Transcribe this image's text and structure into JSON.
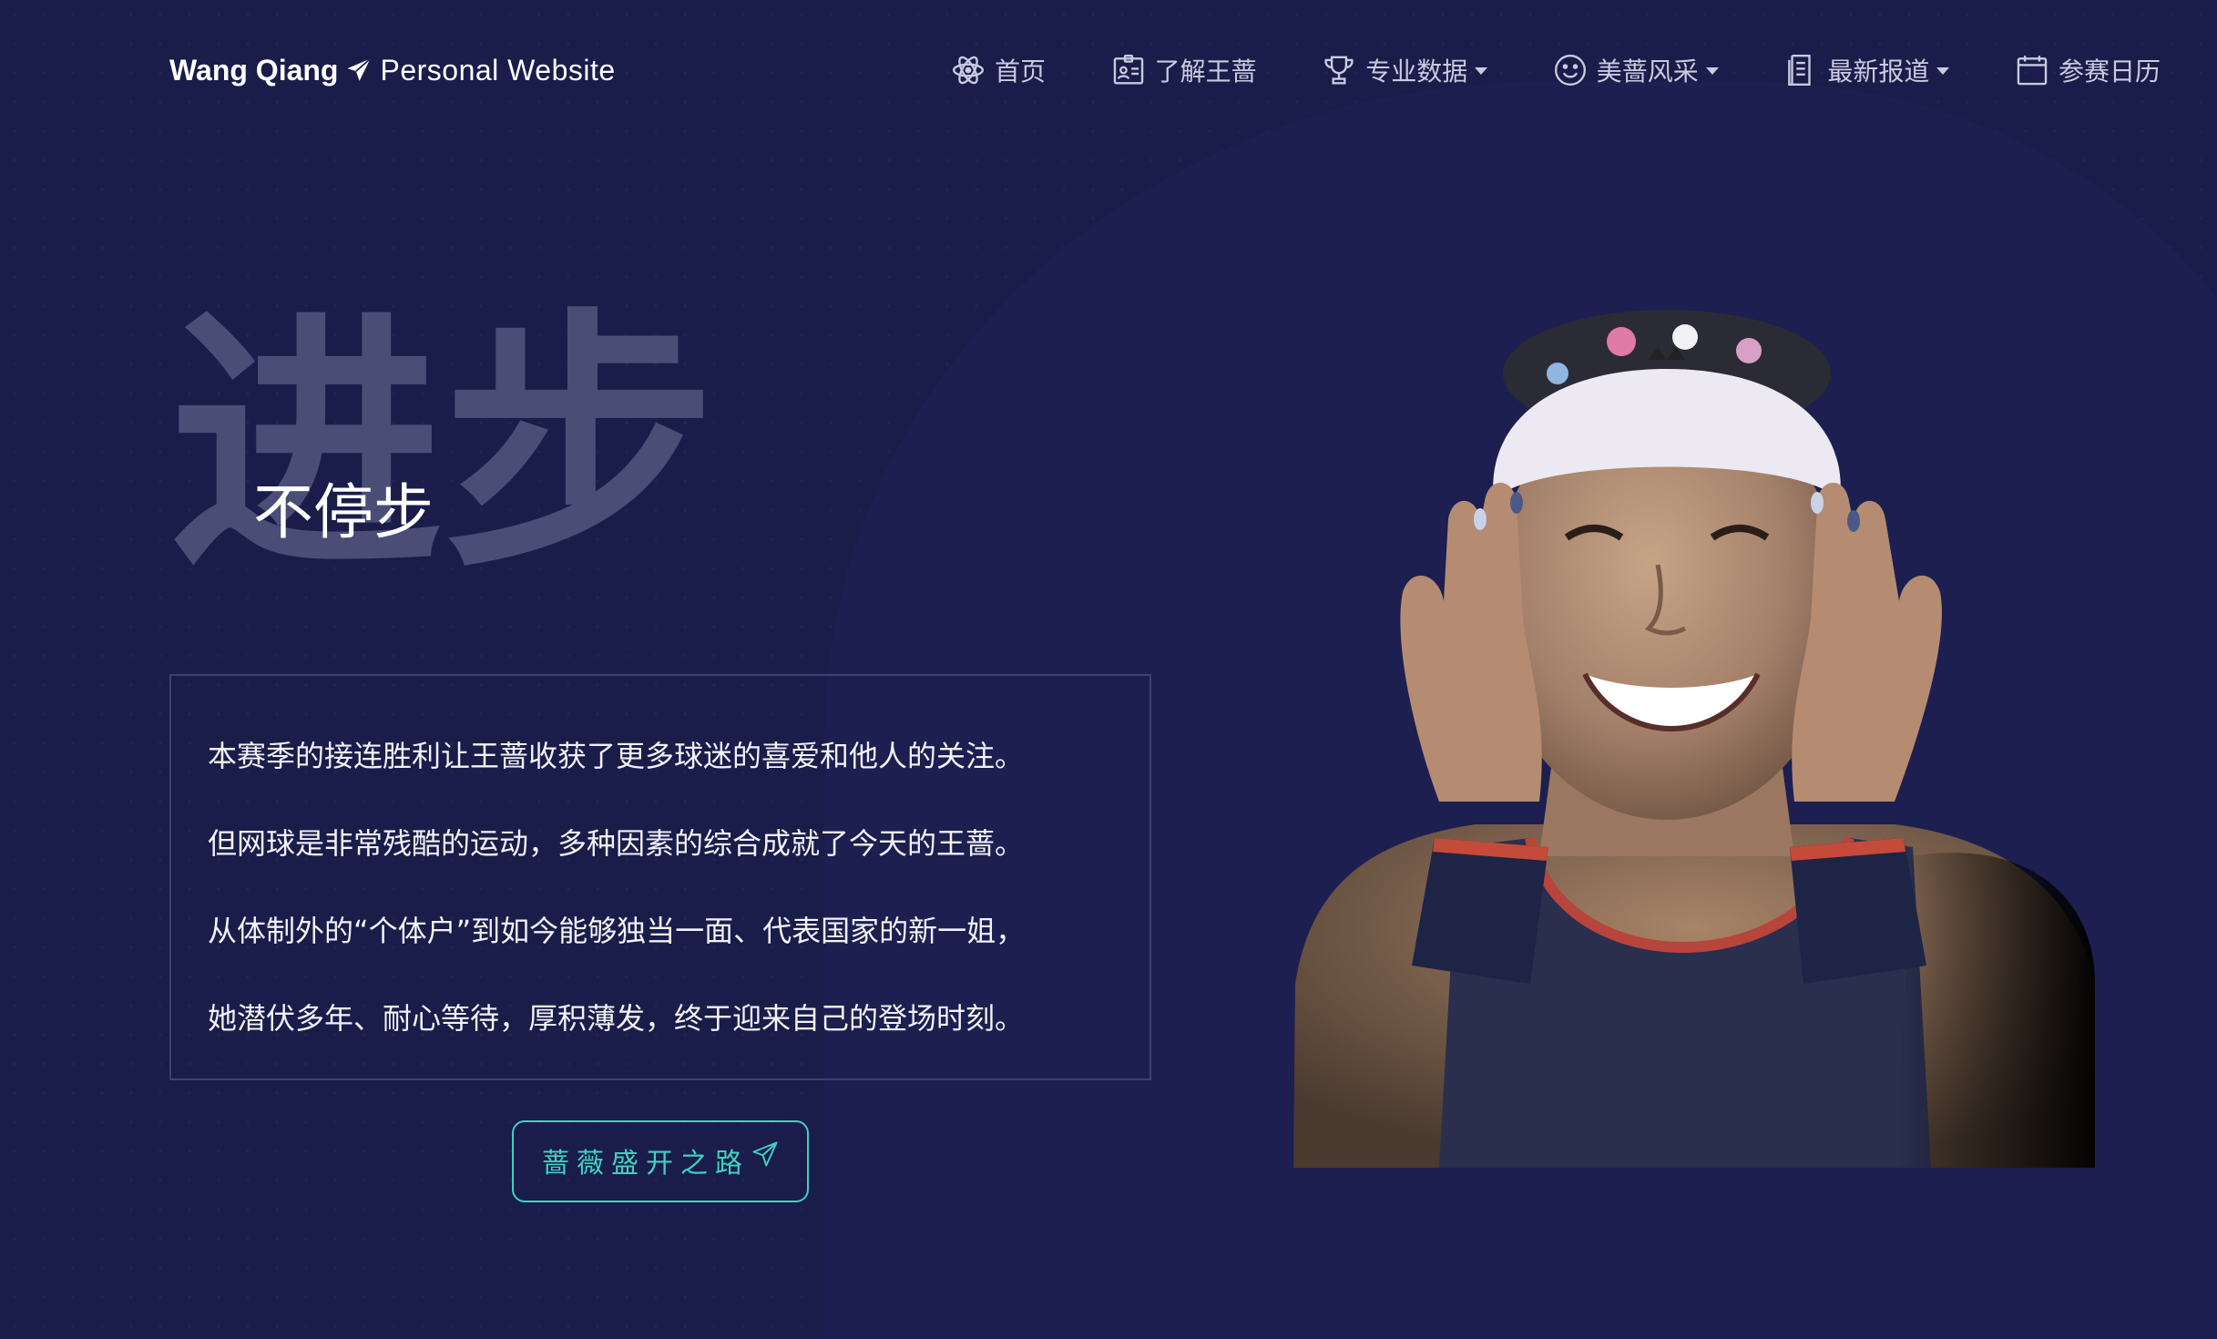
{
  "brand": {
    "name": "Wang Qiang",
    "site": "Personal Website"
  },
  "nav": [
    {
      "label": "首页",
      "icon": "atom-icon",
      "dropdown": false
    },
    {
      "label": "了解王蔷",
      "icon": "id-card-icon",
      "dropdown": true
    },
    {
      "label": "专业数据",
      "icon": "trophy-icon",
      "dropdown": true
    },
    {
      "label": "美蔷风采",
      "icon": "smile-icon",
      "dropdown": true
    },
    {
      "label": "最新报道",
      "icon": "newspaper-icon",
      "dropdown": true
    },
    {
      "label": "参赛日历",
      "icon": "calendar-icon",
      "dropdown": false
    }
  ],
  "hero": {
    "big_text": "进步",
    "small_text": "不停步",
    "intro_lines": [
      "本赛季的接连胜利让王蔷收获了更多球迷的喜爱和他人的关注。",
      "但网球是非常残酷的运动，多种因素的综合成就了今天的王蔷。",
      "从体制外的“个体户”到如今能够独当一面、代表国家的新一姐，",
      "她潜伏多年、耐心等待，厚积薄发，终于迎来自己的登场时刻。"
    ],
    "cta_label": "蔷薇盛开之路"
  },
  "photo": {
    "subject": "player-celebrating-photo"
  },
  "colors": {
    "background": "#1a1c4a",
    "accent": "#3fd1c0",
    "big_text": "#4a4d75",
    "nav_text": "#c9cbe0"
  }
}
